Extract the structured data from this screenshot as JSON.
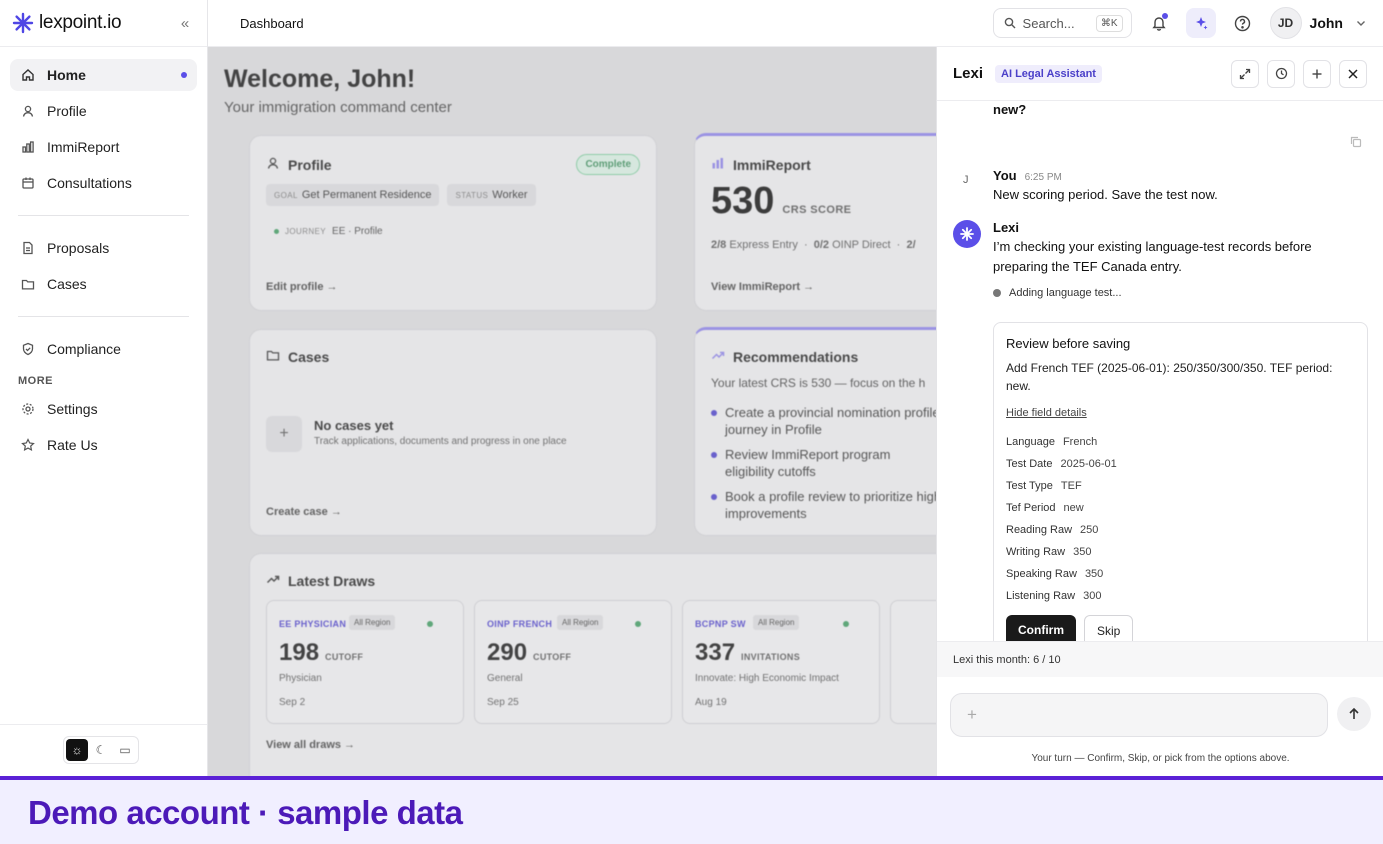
{
  "app": {
    "logo_text": "lexpoint.io"
  },
  "sidebar": {
    "items": [
      {
        "label": "Home",
        "icon": "home-icon",
        "active": true
      },
      {
        "label": "Profile",
        "icon": "user-icon"
      },
      {
        "label": "ImmiReport",
        "icon": "chart-icon"
      },
      {
        "label": "Consultations",
        "icon": "calendar-icon"
      },
      {
        "label": "Proposals",
        "icon": "document-icon"
      },
      {
        "label": "Cases",
        "icon": "folder-icon"
      },
      {
        "label": "Compliance",
        "icon": "shield-icon"
      }
    ],
    "more_label": "MORE",
    "more_items": [
      {
        "label": "Settings",
        "icon": "gear-icon"
      },
      {
        "label": "Rate Us",
        "icon": "star-icon"
      }
    ]
  },
  "topbar": {
    "breadcrumb": "Dashboard",
    "search_placeholder": "Search...",
    "search_shortcut": "⌘K",
    "user_initials": "JD",
    "user_name": "John"
  },
  "dashboard": {
    "welcome": "Welcome, John!",
    "subtitle": "Your immigration command center",
    "profile_card": {
      "title": "Profile",
      "badge": "Complete",
      "goal_label": "GOAL",
      "goal_value": "Get Permanent Residence",
      "status_label": "STATUS",
      "status_value": "Worker",
      "journey_label": "JOURNEY",
      "journey_value": "EE · Profile",
      "link": "Edit profile →"
    },
    "immireport_card": {
      "title": "ImmiReport",
      "score": "530",
      "score_label": "CRS SCORE",
      "stat1_value": "2/8",
      "stat1_label": "Express Entry",
      "stat2_value": "0/2",
      "stat2_label": "OINP Direct",
      "stat3_value": "2/",
      "link": "View ImmiReport →"
    },
    "cases_card": {
      "title": "Cases",
      "empty_title": "No cases yet",
      "empty_sub": "Track applications, documents and progress in one place",
      "link": "Create case →"
    },
    "recommendations_card": {
      "title": "Recommendations",
      "intro": "Your latest CRS is 530 — focus on the h",
      "items": [
        "Create a provincial nomination profile journey in Profile",
        "Review ImmiReport program eligibility cutoffs",
        "Book a profile review to prioritize high improvements"
      ]
    },
    "latest_draws": {
      "title": "Latest Draws",
      "link": "View all draws →",
      "draws": [
        {
          "tag": "EE PHYSICIAN",
          "region": "All Region",
          "number": "198",
          "unit": "CUTOFF",
          "sub": "Physician",
          "date": "Sep 2"
        },
        {
          "tag": "OINP FRENCH",
          "region": "All Region",
          "number": "290",
          "unit": "CUTOFF",
          "sub": "General",
          "date": "Sep 25"
        },
        {
          "tag": "BCPNP SW",
          "region": "All Region",
          "number": "337",
          "unit": "INVITATIONS",
          "sub": "Innovate: High Economic Impact",
          "date": "Aug 19"
        }
      ]
    }
  },
  "lexi": {
    "name": "Lexi",
    "tag": "AI Legal Assistant",
    "prev_text": "new?",
    "user_msg": {
      "initial": "J",
      "author": "You",
      "time": "6:25 PM",
      "text": "New scoring period. Save the test now."
    },
    "bot_msg": {
      "author": "Lexi",
      "text": "I’m checking your existing language-test records before preparing the TEF Canada entry.",
      "status": "Adding language test..."
    },
    "review": {
      "title": "Review before saving",
      "summary": "Add French TEF (2025-06-01): 250/350/300/350. TEF period: new.",
      "hide_link": "Hide field details",
      "fields": [
        {
          "k": "Language",
          "v": "French"
        },
        {
          "k": "Test Date",
          "v": "2025-06-01"
        },
        {
          "k": "Test Type",
          "v": "TEF"
        },
        {
          "k": "Tef Period",
          "v": "new"
        },
        {
          "k": "Reading Raw",
          "v": "250"
        },
        {
          "k": "Writing Raw",
          "v": "350"
        },
        {
          "k": "Speaking Raw",
          "v": "350"
        },
        {
          "k": "Listening Raw",
          "v": "300"
        }
      ],
      "confirm": "Confirm",
      "skip": "Skip"
    },
    "quota": "Lexi this month: 6 / 10",
    "composer_plus": "+",
    "hint": "Your turn — Confirm, Skip, or pick from the options above."
  },
  "banner": {
    "text": "Demo account · sample data"
  },
  "colors": {
    "accent": "#5b4fe8",
    "banner_text": "#4c1ab8",
    "banner_bg": "#f1efff"
  }
}
